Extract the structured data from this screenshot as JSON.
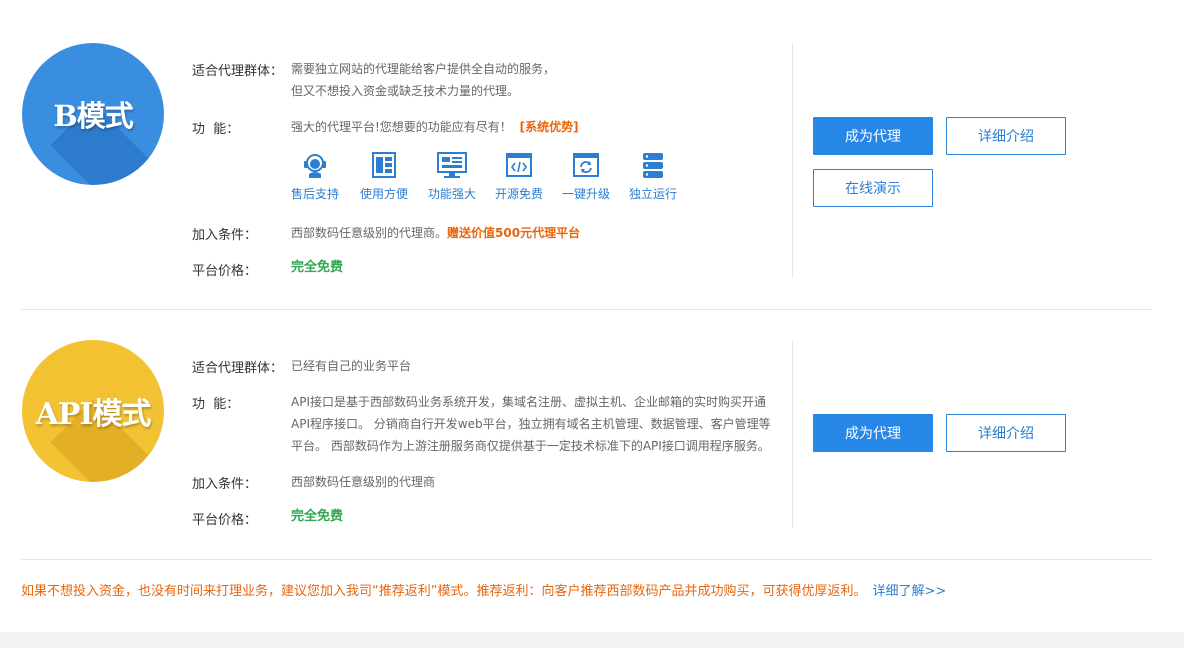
{
  "b_mode": {
    "badge_text": "B模式",
    "target_label": "适合代理群体：",
    "target_line1": "需要独立网站的代理能给客户提供全自动的服务，",
    "target_line2": "但又不想投入资金或缺乏技术力量的代理。",
    "function_label": "功  能：",
    "function_text": "强大的代理平台!您想要的功能应有尽有！",
    "function_highlight": "[系统优势]",
    "features": [
      {
        "label": "售后支持",
        "icon": "headset-icon"
      },
      {
        "label": "使用方便",
        "icon": "layout-icon"
      },
      {
        "label": "功能强大",
        "icon": "monitor-icon"
      },
      {
        "label": "开源免费",
        "icon": "code-icon"
      },
      {
        "label": "一键升级",
        "icon": "refresh-icon"
      },
      {
        "label": "独立运行",
        "icon": "server-icon"
      }
    ],
    "join_label": "加入条件：",
    "join_text": "西部数码任意级别的代理商。",
    "join_highlight": "赠送价值500元代理平台",
    "price_label": "平台价格：",
    "price_text": "完全免费",
    "btn_become": "成为代理",
    "btn_detail": "详细介绍",
    "btn_demo": "在线演示"
  },
  "api_mode": {
    "badge_text": "API模式",
    "target_label": "适合代理群体：",
    "target_text": "已经有自己的业务平台",
    "function_label": "功  能：",
    "function_line1": "API接口是基于西部数码业务系统开发，集域名注册、虚拟主机、企业邮箱的实时购买开通",
    "function_line2": "API程序接口。 分销商自行开发web平台，独立拥有域名主机管理、数据管理、客户管理等",
    "function_line3": "平台。 西部数码作为上游注册服务商仅提供基于一定技术标准下的API接口调用程序服务。",
    "join_label": "加入条件：",
    "join_text": "西部数码任意级别的代理商",
    "price_label": "平台价格：",
    "price_text": "完全免费",
    "btn_become": "成为代理",
    "btn_detail": "详细介绍"
  },
  "note": {
    "text": "如果不想投入资金，也没有时间来打理业务，建议您加入我司“推荐返利”模式。推荐返利：向客户推荐西部数码产品并成功购买，可获得优厚返利。",
    "more": "详细了解>>"
  },
  "colors": {
    "primary": "#2787e6",
    "link": "#2b7ed1",
    "orange": "#e8660d",
    "green": "#2fa84f",
    "b_badge": "#3a8ee0",
    "api_badge": "#f2c233"
  }
}
